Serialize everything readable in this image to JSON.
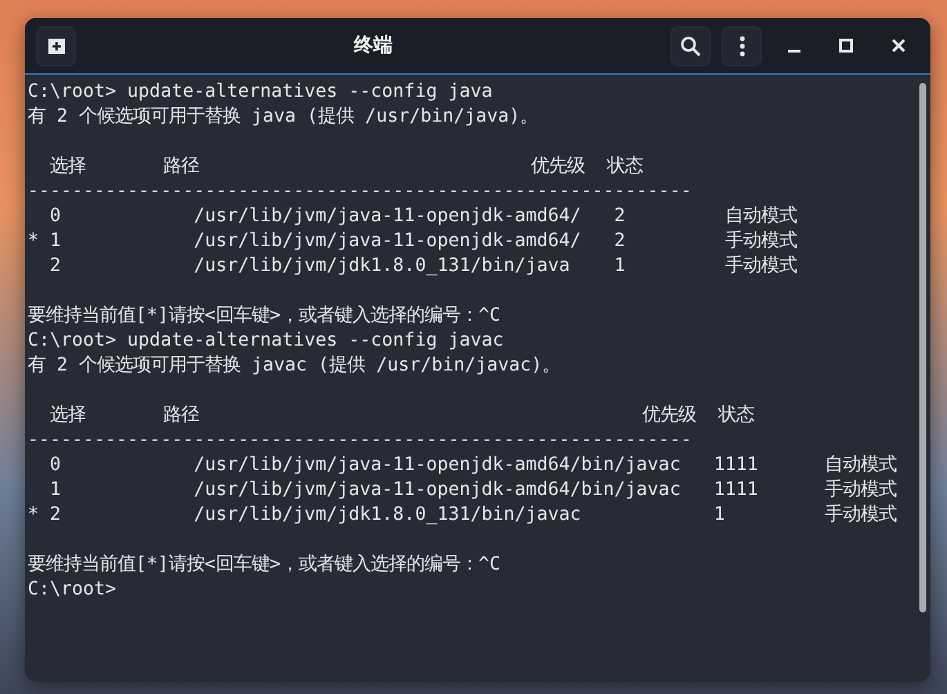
{
  "window": {
    "title": "终端"
  },
  "terminal": {
    "lines": [
      {
        "kind": "text",
        "text": "C:\\root> update-alternatives --config java"
      },
      {
        "kind": "text",
        "text": "有 2 个候选项可用于替换 java (提供 /usr/bin/java)。"
      },
      {
        "kind": "blank"
      },
      {
        "kind": "text",
        "text": "  选择       路径                              优先级  状态"
      },
      {
        "kind": "text",
        "text": "------------------------------------------------------------"
      },
      {
        "kind": "text",
        "text": "  0            /usr/lib/jvm/java-11-openjdk-amd64/   2         自动模式"
      },
      {
        "kind": "text",
        "text": "* 1            /usr/lib/jvm/java-11-openjdk-amd64/   2         手动模式"
      },
      {
        "kind": "text",
        "text": "  2            /usr/lib/jvm/jdk1.8.0_131/bin/java    1         手动模式"
      },
      {
        "kind": "blank"
      },
      {
        "kind": "text",
        "text": "要维持当前值[*]请按<回车键>，或者键入选择的编号：^C"
      },
      {
        "kind": "text",
        "text": "C:\\root> update-alternatives --config javac"
      },
      {
        "kind": "text",
        "text": "有 2 个候选项可用于替换 javac (提供 /usr/bin/javac)。"
      },
      {
        "kind": "blank"
      },
      {
        "kind": "text",
        "text": "  选择       路径                                        优先级  状态"
      },
      {
        "kind": "text",
        "text": "------------------------------------------------------------"
      },
      {
        "kind": "text",
        "text": "  0            /usr/lib/jvm/java-11-openjdk-amd64/bin/javac   1111      自动模式"
      },
      {
        "kind": "text",
        "text": "  1            /usr/lib/jvm/java-11-openjdk-amd64/bin/javac   1111      手动模式"
      },
      {
        "kind": "text",
        "text": "* 2            /usr/lib/jvm/jdk1.8.0_131/bin/javac            1         手动模式"
      },
      {
        "kind": "blank"
      },
      {
        "kind": "text",
        "text": "要维持当前值[*]请按<回车键>，或者键入选择的编号：^C"
      },
      {
        "kind": "text",
        "text": "C:\\root>"
      }
    ]
  }
}
